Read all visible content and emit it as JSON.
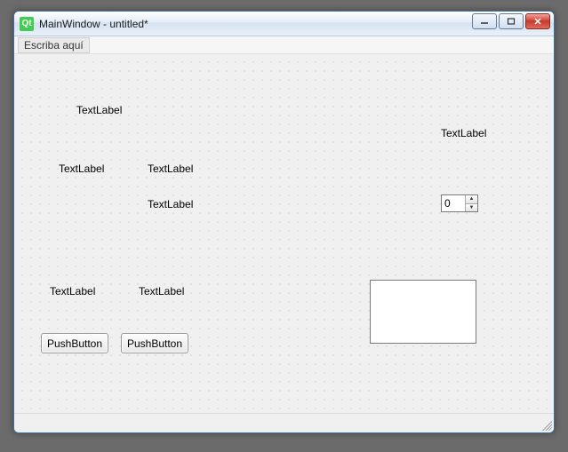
{
  "window": {
    "title": "MainWindow - untitled*"
  },
  "menubar": {
    "placeholder": "Escriba aquí"
  },
  "labels": {
    "l1": "TextLabel",
    "l2": "TextLabel",
    "l3": "TextLabel",
    "l4": "TextLabel",
    "l5": "TextLabel",
    "l6": "TextLabel",
    "l7": "TextLabel"
  },
  "buttons": {
    "pb1": "PushButton",
    "pb2": "PushButton"
  },
  "spinbox": {
    "value": "0"
  }
}
